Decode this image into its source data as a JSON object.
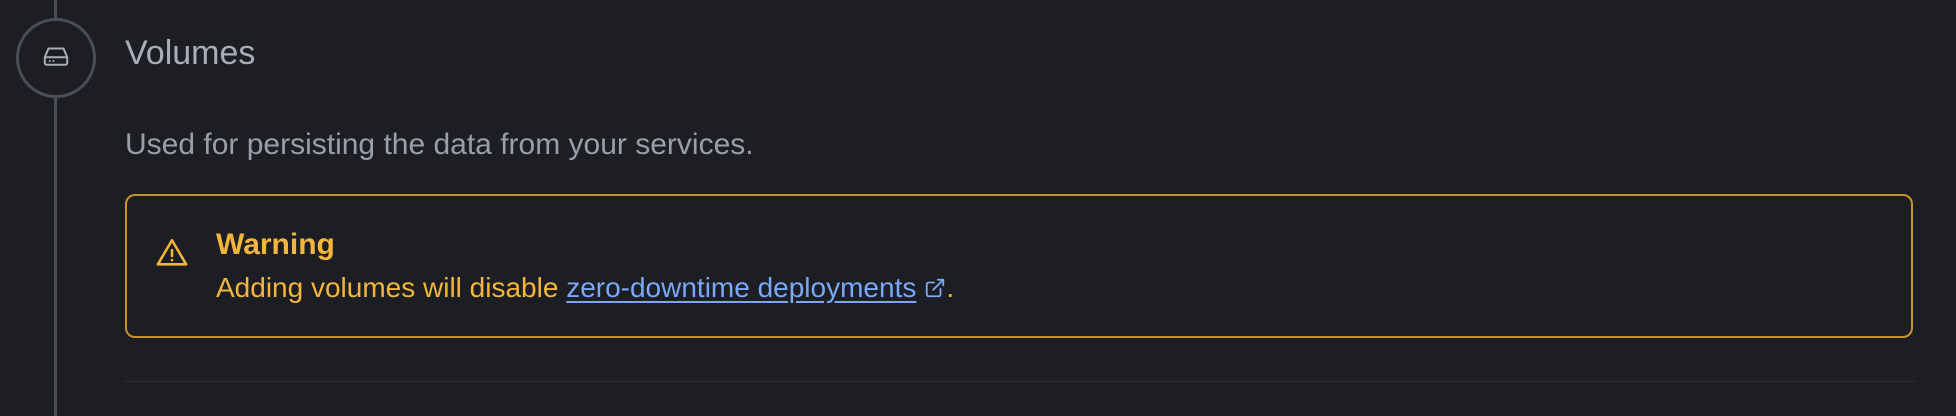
{
  "section": {
    "title": "Volumes",
    "description": "Used for persisting the data from your services.",
    "icon": "hard-drive-icon"
  },
  "warning": {
    "icon": "warning-triangle-icon",
    "title": "Warning",
    "text_before": "Adding volumes will disable ",
    "link_label": "zero-downtime deployments",
    "link_icon": "external-link-icon",
    "text_after": "."
  },
  "colors": {
    "background": "#1c1e24",
    "timeline": "#4b4e56",
    "warning_accent": "#f3b63b",
    "warning_border": "#c9932c",
    "link": "#7aa8f5"
  }
}
